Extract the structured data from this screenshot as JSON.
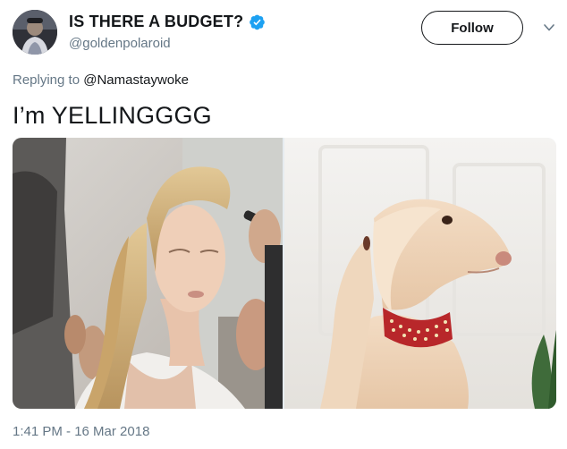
{
  "author": {
    "display_name": "IS THERE A BUDGET?",
    "handle": "@goldenpolaroid",
    "verified": true,
    "avatar_icon": "profile-photo"
  },
  "actions": {
    "follow_label": "Follow",
    "more_icon": "chevron-down-icon"
  },
  "reply": {
    "prefix": "Replying to",
    "mention": "@Namastaywoke"
  },
  "tweet": {
    "text": "I’m YELLINGGGG",
    "timestamp": "1:41 PM - 16 Mar 2018"
  },
  "media": [
    {
      "name": "photo-woman-ponytail"
    },
    {
      "name": "photo-dog-ponytail"
    }
  ],
  "colors": {
    "text": "#14171a",
    "secondary": "#657786",
    "verified_blue": "#1da1f2"
  }
}
